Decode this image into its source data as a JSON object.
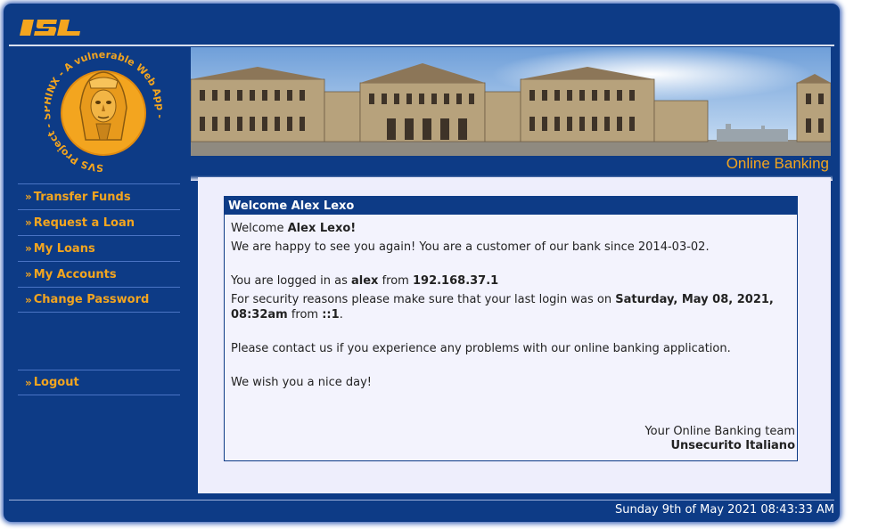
{
  "header": {
    "logo_text": "ISL"
  },
  "sidebar": {
    "emblem_text": "SVS Project - SPHINX - A vulnerable Web App -",
    "items": [
      {
        "label": "Transfer Funds"
      },
      {
        "label": "Request a Loan"
      },
      {
        "label": "My Loans"
      },
      {
        "label": "My Accounts"
      },
      {
        "label": "Change Password"
      }
    ],
    "logout": {
      "label": "Logout"
    },
    "arrow": "»"
  },
  "banner": {
    "caption": "Online Banking"
  },
  "welcome": {
    "title": "Welcome Alex Lexo",
    "greeting_prefix": "Welcome ",
    "greeting_name": "Alex Lexo!",
    "since_text": "We are happy to see you again! You are a customer of our bank since 2014-03-02.",
    "logged_prefix": "You are logged in as ",
    "username": "alex",
    "logged_mid": " from ",
    "ip": "192.168.37.1",
    "security_prefix": "For security reasons please make sure that your last login was on ",
    "last_login": "Saturday, May 08, 2021, 08:32am",
    "security_mid": " from ",
    "last_ip": "::1",
    "security_suffix": ".",
    "contact_text": "Please contact us if you experience any problems with our online banking application.",
    "wish_text": "We wish you a nice day!",
    "team_line": "Your Online Banking team",
    "team_name": "Unsecurito Italiano"
  },
  "status": {
    "datetime": "Sunday 9th of May 2021 08:43:33 AM"
  },
  "colors": {
    "primary": "#0d3b86",
    "accent": "#f3a51f",
    "content_bg": "#eeeefc"
  }
}
